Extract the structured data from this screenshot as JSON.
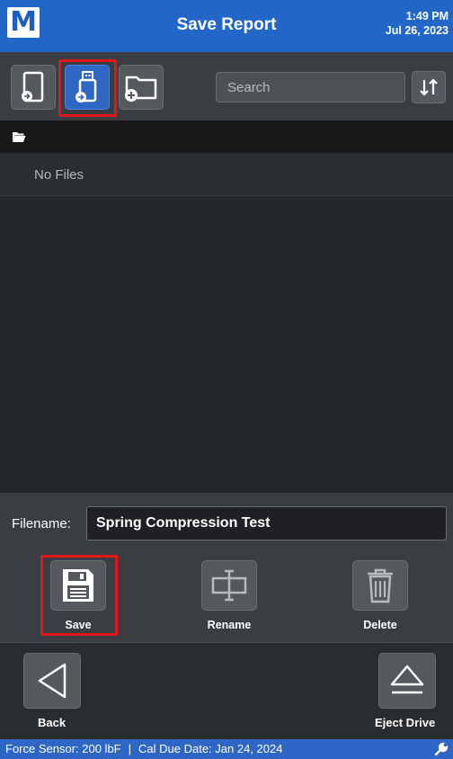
{
  "header": {
    "logo_letter": "M",
    "title": "Save Report",
    "time": "1:49 PM",
    "date": "Jul 26, 2023"
  },
  "toolbar": {
    "buttons": [
      {
        "icon": "internal-storage-icon",
        "active": false
      },
      {
        "icon": "usb-drive-icon",
        "active": true
      },
      {
        "icon": "new-folder-icon",
        "active": false
      }
    ],
    "search": {
      "placeholder": "Search",
      "value": ""
    },
    "sort_icon": "sort-icon"
  },
  "path": {
    "icon": "folder-open-icon"
  },
  "file_list": {
    "empty_message": "No Files"
  },
  "filename": {
    "label": "Filename:",
    "value": "Spring Compression Test"
  },
  "actions": {
    "save": "Save",
    "rename": "Rename",
    "delete": "Delete"
  },
  "nav": {
    "back": "Back",
    "eject": "Eject Drive"
  },
  "status": {
    "sensor": "Force Sensor: 200 lbF",
    "separator": "|",
    "cal_due": "Cal Due Date: Jan 24, 2024"
  },
  "colors": {
    "header_blue": "#2267c8",
    "active_button": "#2e67c4",
    "highlight_red": "#e0161b"
  }
}
